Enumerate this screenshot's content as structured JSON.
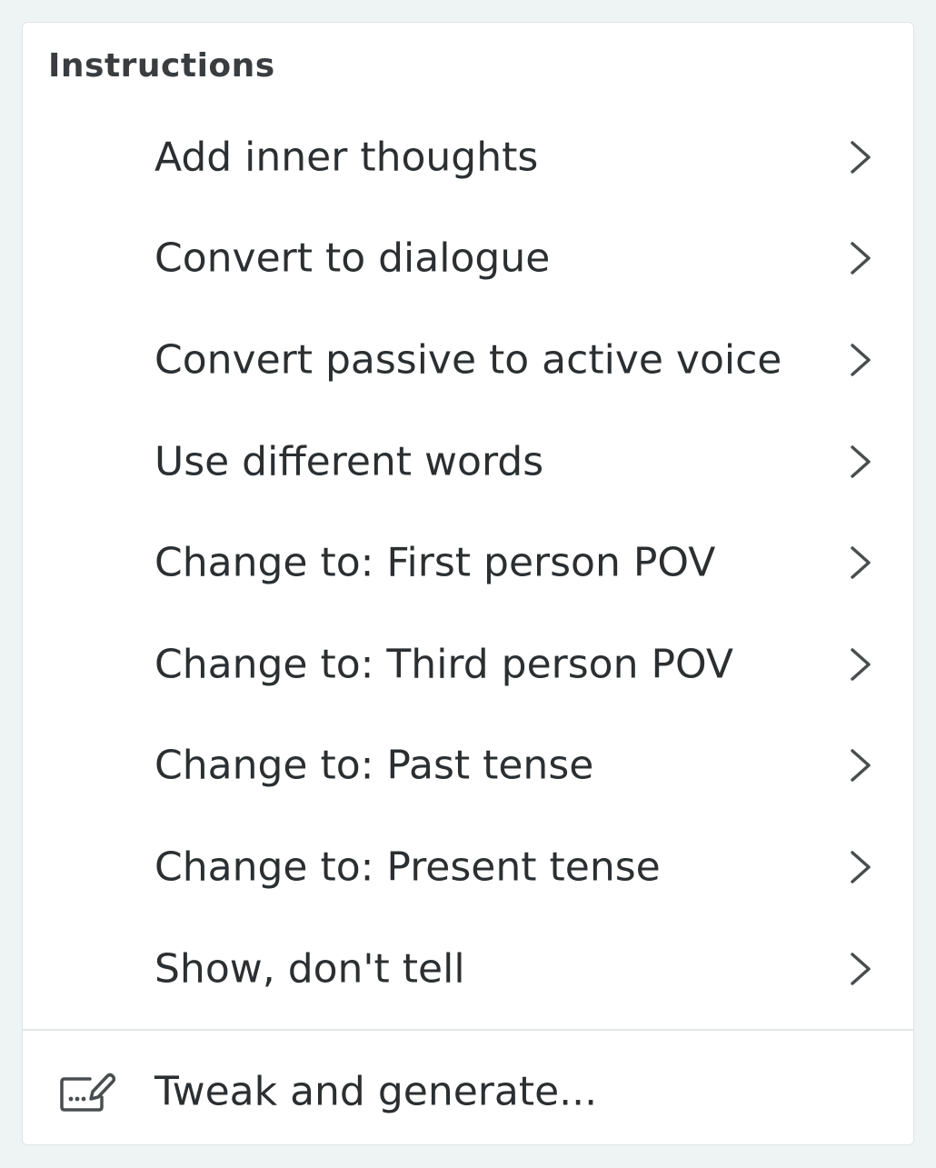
{
  "menu": {
    "section_title": "Instructions",
    "items": [
      {
        "label": "Add inner thoughts",
        "icon": "chevron-right-icon"
      },
      {
        "label": "Convert to dialogue",
        "icon": "chevron-right-icon"
      },
      {
        "label": "Convert passive to active voice",
        "icon": "chevron-right-icon"
      },
      {
        "label": "Use different words",
        "icon": "chevron-right-icon"
      },
      {
        "label": "Change to: First person POV",
        "icon": "chevron-right-icon"
      },
      {
        "label": "Change to: Third person POV",
        "icon": "chevron-right-icon"
      },
      {
        "label": "Change to: Past tense",
        "icon": "chevron-right-icon"
      },
      {
        "label": "Change to: Present tense",
        "icon": "chevron-right-icon"
      },
      {
        "label": "Show, don't tell",
        "icon": "chevron-right-icon"
      }
    ],
    "tweak": {
      "label": "Tweak and generate...",
      "icon": "edit-prompt-icon"
    }
  },
  "colors": {
    "background": "#eef3f3",
    "panel": "#ffffff",
    "text": "#2c2f31",
    "icon": "#4a4d50",
    "divider": "#e3e6e6"
  }
}
